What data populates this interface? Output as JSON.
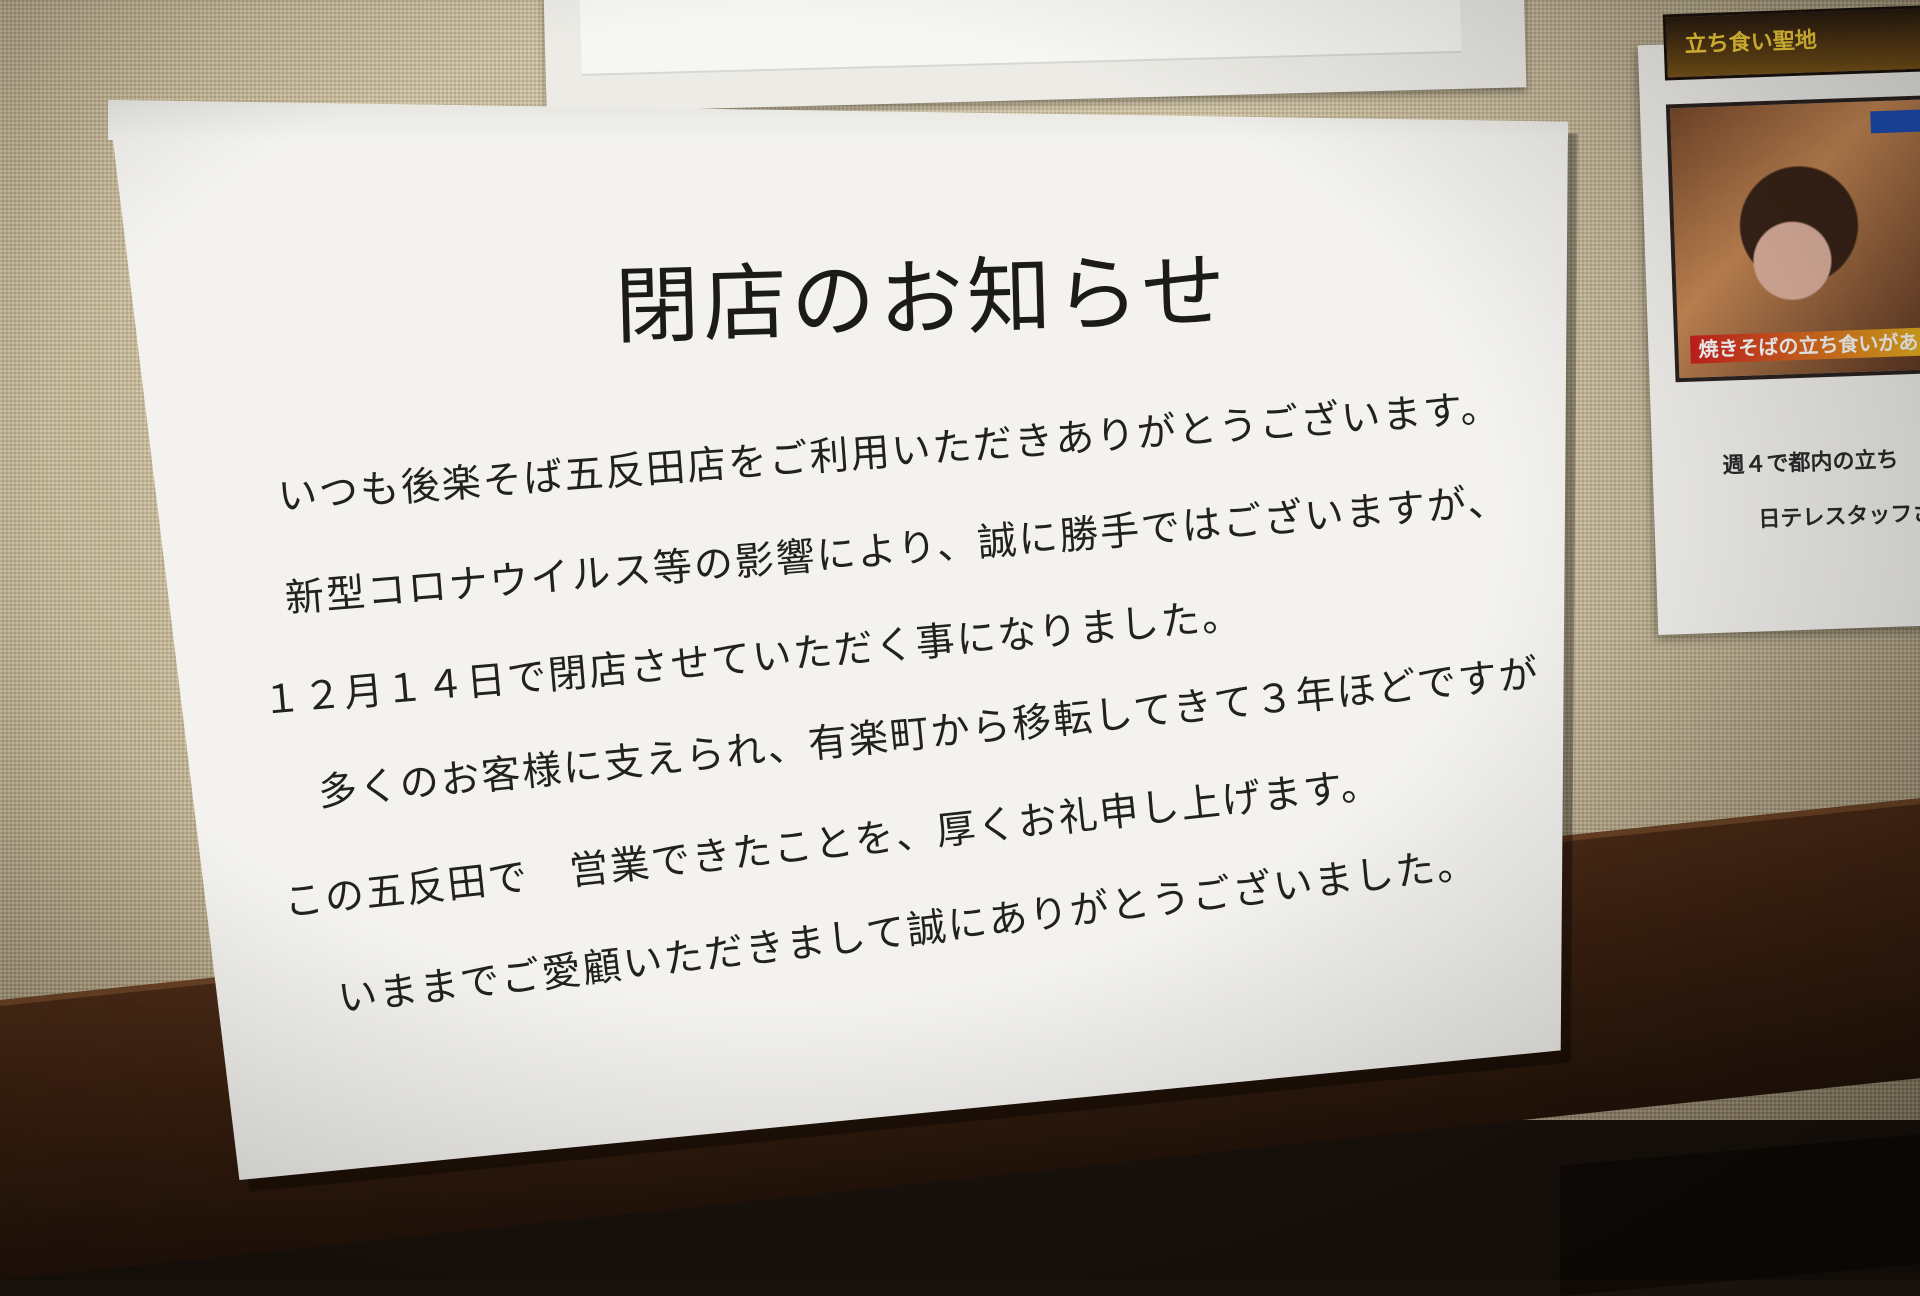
{
  "notice": {
    "title": "閉店のお知らせ",
    "lines": [
      "いつも後楽そば五反田店をご利用いただきありがとうございます。",
      "新型コロナウイルス等の影響により、誠に勝手ではございますが、",
      "１２月１４日で閉店させていただく事になりました。",
      "多くのお客様に支えられ、有楽町から移転してきて３年ほどですが",
      "この五反田で　営業できたことを、厚くお礼申し上げます。",
      "いままでご愛顧いただきまして誠にありがとうございました。"
    ]
  },
  "side_poster": {
    "banner_text": "立ち食い聖地",
    "caption": "焼きそばの立ち食いがあっ",
    "text_line1": "週４で都内の立ち",
    "text_line2": "日テレスタッフさ"
  }
}
